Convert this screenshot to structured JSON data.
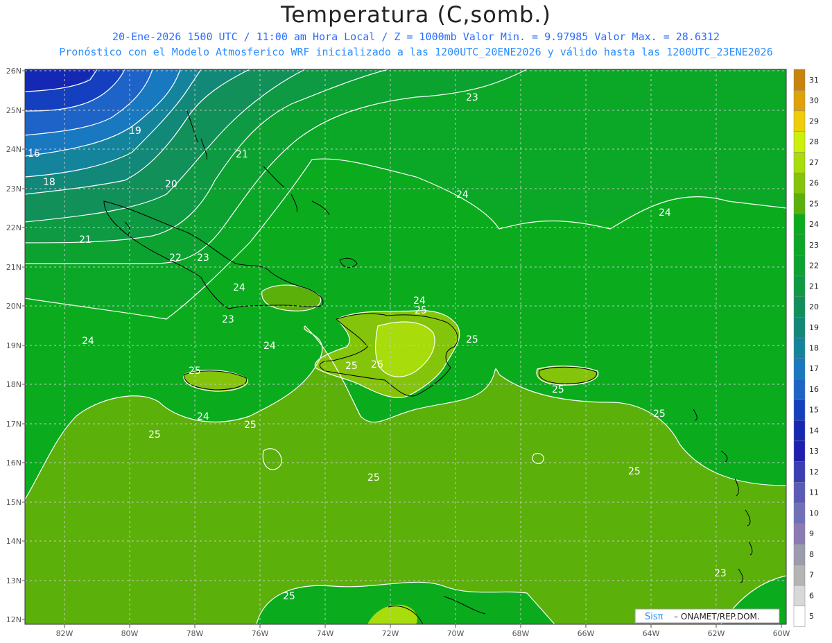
{
  "title": "Temperatura (C,somb.)",
  "subtitle_line1": "20-Ene-2026 1500 UTC / 11:00 am Hora Local / Z = 1000mb  Valor Min. = 9.97985  Valor Max. = 28.6312",
  "subtitle_line2": "Pronóstico con el Modelo Atmosferico WRF inicializado a las 1200UTC_20ENE2026 y válido hasta las  1200UTC_23ENE2026",
  "credit": {
    "brand": "Sisπ",
    "text": "– ONAMET/REP.DOM."
  },
  "lat_labels": [
    "26N",
    "25N",
    "24N",
    "23N",
    "22N",
    "21N",
    "20N",
    "19N",
    "18N",
    "17N",
    "16N",
    "15N",
    "14N",
    "13N",
    "12N"
  ],
  "lon_labels": [
    "82W",
    "80W",
    "78W",
    "76W",
    "74W",
    "72W",
    "70W",
    "68W",
    "66W",
    "64W",
    "62W",
    "60W"
  ],
  "colorbar": {
    "levels": [
      "5",
      "6",
      "7",
      "8",
      "9",
      "10",
      "11",
      "12",
      "13",
      "14",
      "15",
      "16",
      "17",
      "18",
      "19",
      "20",
      "21",
      "22",
      "23",
      "24",
      "25",
      "26",
      "27",
      "28",
      "29",
      "30",
      "31"
    ],
    "colors": [
      "#ffffff",
      "#d8d8d8",
      "#b4b4b4",
      "#9c9cb0",
      "#8c7ab4",
      "#7070b8",
      "#5a5ab8",
      "#3c3cb4",
      "#1e1eb0",
      "#1428b4",
      "#1440c0",
      "#1e64c8",
      "#1878c0",
      "#14849c",
      "#128878",
      "#12905a",
      "#0e9a42",
      "#0ca230",
      "#0aa826",
      "#0aac1e",
      "#5cb00a",
      "#84c40a",
      "#a8dc0a",
      "#ccf00a",
      "#f0cc0a",
      "#e0a00a",
      "#c8840a"
    ]
  },
  "contour_labels": [
    "16",
    "18",
    "19",
    "20",
    "21",
    "21",
    "22",
    "23",
    "23",
    "23",
    "24",
    "24",
    "24",
    "24",
    "24",
    "24",
    "24",
    "25",
    "25",
    "25",
    "25",
    "25",
    "25",
    "25",
    "25",
    "25",
    "25",
    "25",
    "26",
    "23"
  ]
}
